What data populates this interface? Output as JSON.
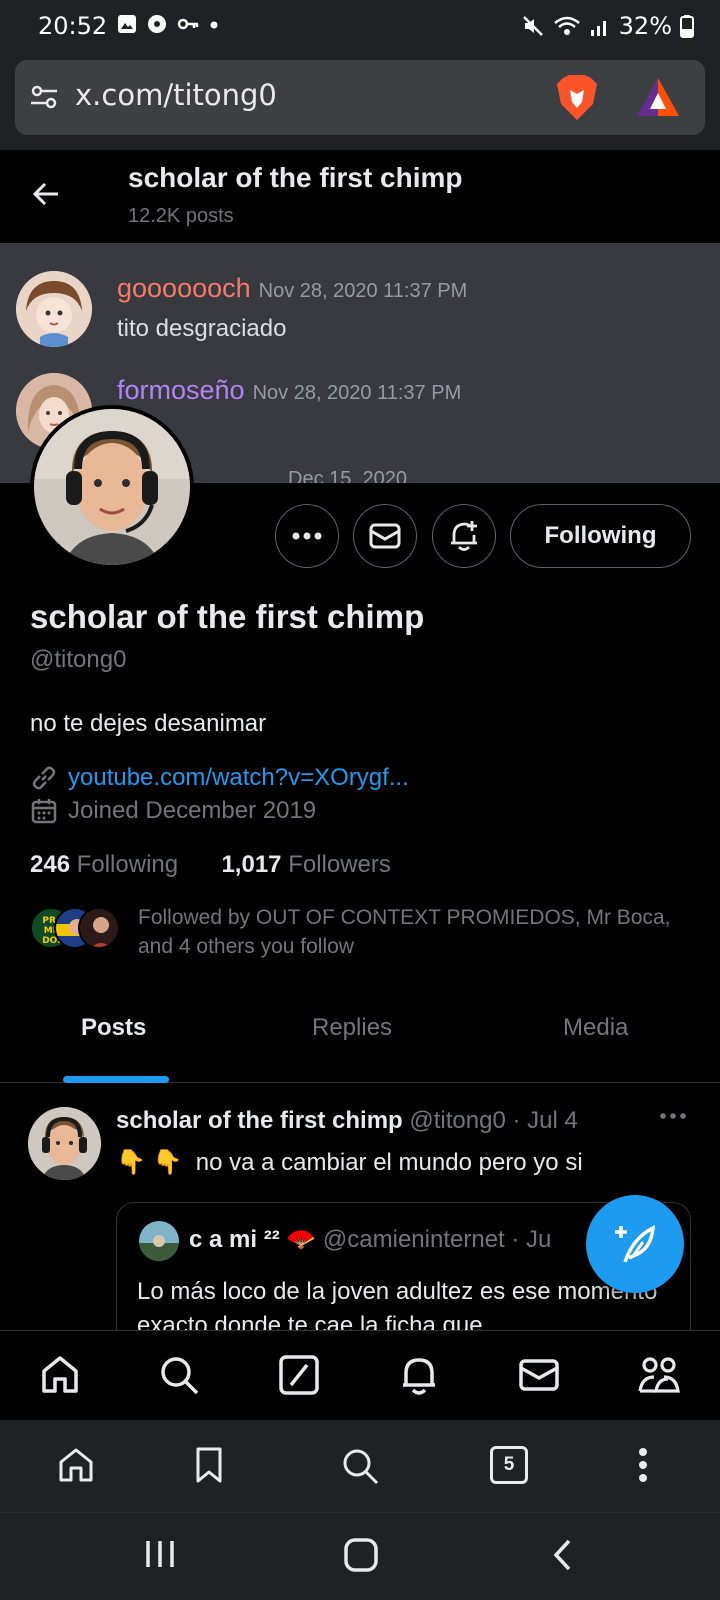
{
  "status_bar": {
    "time": "20:52",
    "battery": "32%"
  },
  "browser": {
    "url": "x.com/titong0",
    "tab_count": "5"
  },
  "header": {
    "title": "scholar of the first chimp",
    "posts_count": "12.2K posts"
  },
  "banner": {
    "messages": [
      {
        "username": "gooooooch",
        "date": "Nov 28, 2020 11:37 PM",
        "text": "tito desgraciado",
        "name_color": "#f47b67"
      },
      {
        "username": "formoseño",
        "date": "Nov 28, 2020 11:37 PM",
        "text": "",
        "name_color": "#b084f5"
      }
    ],
    "partial_date": "Dec 15, 2020"
  },
  "profile": {
    "follow_button": "Following",
    "display_name": "scholar of the first chimp",
    "handle": "@titong0",
    "bio": "no te dejes desanimar",
    "link": "youtube.com/watch?v=XOrygf...",
    "joined": "Joined December 2019",
    "following_count": "246",
    "following_label": "Following",
    "followers_count": "1,017",
    "followers_label": "Followers",
    "followed_by": "Followed by OUT OF CONTEXT PROMIEDOS, Mr Boca, and 4 others you follow"
  },
  "tabs": [
    "Posts",
    "Replies",
    "Media"
  ],
  "post": {
    "author": "scholar of the first chimp",
    "meta": "@titong0 · Jul 4",
    "emoji": "👇 👇",
    "text": "no va a cambiar el mundo pero yo si",
    "quote": {
      "author": "c a mi ²² 🪭",
      "meta": "@camieninternet · Ju",
      "text": "Lo más loco de la joven adultez es ese momento exacto donde te cae la ficha que"
    }
  },
  "colors": {
    "accent": "#1d9bf0",
    "background": "#000000",
    "banner": "#383a40",
    "browser_chrome": "#202124"
  }
}
